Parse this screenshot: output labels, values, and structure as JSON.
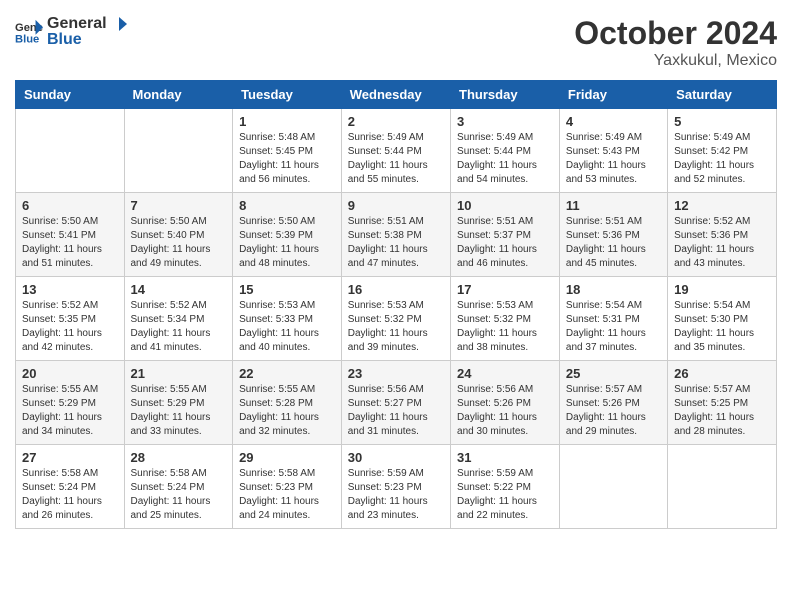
{
  "header": {
    "logo_line1": "General",
    "logo_line2": "Blue",
    "month": "October 2024",
    "location": "Yaxkukul, Mexico"
  },
  "weekdays": [
    "Sunday",
    "Monday",
    "Tuesday",
    "Wednesday",
    "Thursday",
    "Friday",
    "Saturday"
  ],
  "weeks": [
    [
      {
        "day": "",
        "info": ""
      },
      {
        "day": "",
        "info": ""
      },
      {
        "day": "1",
        "info": "Sunrise: 5:48 AM\nSunset: 5:45 PM\nDaylight: 11 hours and 56 minutes."
      },
      {
        "day": "2",
        "info": "Sunrise: 5:49 AM\nSunset: 5:44 PM\nDaylight: 11 hours and 55 minutes."
      },
      {
        "day": "3",
        "info": "Sunrise: 5:49 AM\nSunset: 5:44 PM\nDaylight: 11 hours and 54 minutes."
      },
      {
        "day": "4",
        "info": "Sunrise: 5:49 AM\nSunset: 5:43 PM\nDaylight: 11 hours and 53 minutes."
      },
      {
        "day": "5",
        "info": "Sunrise: 5:49 AM\nSunset: 5:42 PM\nDaylight: 11 hours and 52 minutes."
      }
    ],
    [
      {
        "day": "6",
        "info": "Sunrise: 5:50 AM\nSunset: 5:41 PM\nDaylight: 11 hours and 51 minutes."
      },
      {
        "day": "7",
        "info": "Sunrise: 5:50 AM\nSunset: 5:40 PM\nDaylight: 11 hours and 49 minutes."
      },
      {
        "day": "8",
        "info": "Sunrise: 5:50 AM\nSunset: 5:39 PM\nDaylight: 11 hours and 48 minutes."
      },
      {
        "day": "9",
        "info": "Sunrise: 5:51 AM\nSunset: 5:38 PM\nDaylight: 11 hours and 47 minutes."
      },
      {
        "day": "10",
        "info": "Sunrise: 5:51 AM\nSunset: 5:37 PM\nDaylight: 11 hours and 46 minutes."
      },
      {
        "day": "11",
        "info": "Sunrise: 5:51 AM\nSunset: 5:36 PM\nDaylight: 11 hours and 45 minutes."
      },
      {
        "day": "12",
        "info": "Sunrise: 5:52 AM\nSunset: 5:36 PM\nDaylight: 11 hours and 43 minutes."
      }
    ],
    [
      {
        "day": "13",
        "info": "Sunrise: 5:52 AM\nSunset: 5:35 PM\nDaylight: 11 hours and 42 minutes."
      },
      {
        "day": "14",
        "info": "Sunrise: 5:52 AM\nSunset: 5:34 PM\nDaylight: 11 hours and 41 minutes."
      },
      {
        "day": "15",
        "info": "Sunrise: 5:53 AM\nSunset: 5:33 PM\nDaylight: 11 hours and 40 minutes."
      },
      {
        "day": "16",
        "info": "Sunrise: 5:53 AM\nSunset: 5:32 PM\nDaylight: 11 hours and 39 minutes."
      },
      {
        "day": "17",
        "info": "Sunrise: 5:53 AM\nSunset: 5:32 PM\nDaylight: 11 hours and 38 minutes."
      },
      {
        "day": "18",
        "info": "Sunrise: 5:54 AM\nSunset: 5:31 PM\nDaylight: 11 hours and 37 minutes."
      },
      {
        "day": "19",
        "info": "Sunrise: 5:54 AM\nSunset: 5:30 PM\nDaylight: 11 hours and 35 minutes."
      }
    ],
    [
      {
        "day": "20",
        "info": "Sunrise: 5:55 AM\nSunset: 5:29 PM\nDaylight: 11 hours and 34 minutes."
      },
      {
        "day": "21",
        "info": "Sunrise: 5:55 AM\nSunset: 5:29 PM\nDaylight: 11 hours and 33 minutes."
      },
      {
        "day": "22",
        "info": "Sunrise: 5:55 AM\nSunset: 5:28 PM\nDaylight: 11 hours and 32 minutes."
      },
      {
        "day": "23",
        "info": "Sunrise: 5:56 AM\nSunset: 5:27 PM\nDaylight: 11 hours and 31 minutes."
      },
      {
        "day": "24",
        "info": "Sunrise: 5:56 AM\nSunset: 5:26 PM\nDaylight: 11 hours and 30 minutes."
      },
      {
        "day": "25",
        "info": "Sunrise: 5:57 AM\nSunset: 5:26 PM\nDaylight: 11 hours and 29 minutes."
      },
      {
        "day": "26",
        "info": "Sunrise: 5:57 AM\nSunset: 5:25 PM\nDaylight: 11 hours and 28 minutes."
      }
    ],
    [
      {
        "day": "27",
        "info": "Sunrise: 5:58 AM\nSunset: 5:24 PM\nDaylight: 11 hours and 26 minutes."
      },
      {
        "day": "28",
        "info": "Sunrise: 5:58 AM\nSunset: 5:24 PM\nDaylight: 11 hours and 25 minutes."
      },
      {
        "day": "29",
        "info": "Sunrise: 5:58 AM\nSunset: 5:23 PM\nDaylight: 11 hours and 24 minutes."
      },
      {
        "day": "30",
        "info": "Sunrise: 5:59 AM\nSunset: 5:23 PM\nDaylight: 11 hours and 23 minutes."
      },
      {
        "day": "31",
        "info": "Sunrise: 5:59 AM\nSunset: 5:22 PM\nDaylight: 11 hours and 22 minutes."
      },
      {
        "day": "",
        "info": ""
      },
      {
        "day": "",
        "info": ""
      }
    ]
  ]
}
